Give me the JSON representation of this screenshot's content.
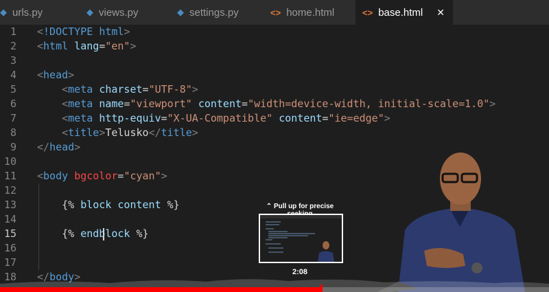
{
  "tabs": [
    {
      "label": "urls.py",
      "icon": "python-file-icon",
      "active": false
    },
    {
      "label": "views.py",
      "icon": "python-file-icon",
      "active": false
    },
    {
      "label": "settings.py",
      "icon": "python-file-icon",
      "active": false
    },
    {
      "label": "home.html",
      "icon": "html-file-icon",
      "active": false
    },
    {
      "label": "base.html",
      "icon": "html-file-icon",
      "active": true,
      "close": "✕"
    }
  ],
  "icons": {
    "python": "◆",
    "html": "<>"
  },
  "editor": {
    "current_line": 15,
    "lines": [
      {
        "n": "1",
        "tokens": [
          [
            "p",
            "<"
          ],
          [
            "tag",
            "!DOCTYPE "
          ],
          [
            "tag",
            "html"
          ],
          [
            "p",
            ">"
          ]
        ]
      },
      {
        "n": "2",
        "tokens": [
          [
            "p",
            "<"
          ],
          [
            "tag",
            "html "
          ],
          [
            "attr",
            "lang"
          ],
          [
            "txt",
            "="
          ],
          [
            "str",
            "\"en\""
          ],
          [
            "p",
            ">"
          ]
        ]
      },
      {
        "n": "3",
        "tokens": []
      },
      {
        "n": "4",
        "tokens": [
          [
            "p",
            "<"
          ],
          [
            "tag",
            "head"
          ],
          [
            "p",
            ">"
          ]
        ]
      },
      {
        "n": "5",
        "tokens": [
          [
            "txt",
            "    "
          ],
          [
            "p",
            "<"
          ],
          [
            "tag",
            "meta "
          ],
          [
            "attr",
            "charset"
          ],
          [
            "txt",
            "="
          ],
          [
            "str",
            "\"UTF-8\""
          ],
          [
            "p",
            ">"
          ]
        ]
      },
      {
        "n": "6",
        "tokens": [
          [
            "txt",
            "    "
          ],
          [
            "p",
            "<"
          ],
          [
            "tag",
            "meta "
          ],
          [
            "attr",
            "name"
          ],
          [
            "txt",
            "="
          ],
          [
            "str",
            "\"viewport\""
          ],
          [
            "txt",
            " "
          ],
          [
            "attr",
            "content"
          ],
          [
            "txt",
            "="
          ],
          [
            "str",
            "\"width=device-width, initial-scale=1.0\""
          ],
          [
            "p",
            ">"
          ]
        ]
      },
      {
        "n": "7",
        "tokens": [
          [
            "txt",
            "    "
          ],
          [
            "p",
            "<"
          ],
          [
            "tag",
            "meta "
          ],
          [
            "attr",
            "http-equiv"
          ],
          [
            "txt",
            "="
          ],
          [
            "str",
            "\"X-UA-Compatible\""
          ],
          [
            "txt",
            " "
          ],
          [
            "attr",
            "content"
          ],
          [
            "txt",
            "="
          ],
          [
            "str",
            "\"ie=edge\""
          ],
          [
            "p",
            ">"
          ]
        ]
      },
      {
        "n": "8",
        "tokens": [
          [
            "txt",
            "    "
          ],
          [
            "p",
            "<"
          ],
          [
            "tag",
            "title"
          ],
          [
            "p",
            ">"
          ],
          [
            "txt",
            "Telusko"
          ],
          [
            "p",
            "</"
          ],
          [
            "tag",
            "title"
          ],
          [
            "p",
            ">"
          ]
        ]
      },
      {
        "n": "9",
        "tokens": [
          [
            "p",
            "</"
          ],
          [
            "tag",
            "head"
          ],
          [
            "p",
            ">"
          ]
        ]
      },
      {
        "n": "10",
        "tokens": []
      },
      {
        "n": "11",
        "tokens": [
          [
            "p",
            "<"
          ],
          [
            "tag",
            "body "
          ],
          [
            "red",
            "bgcolor"
          ],
          [
            "txt",
            "="
          ],
          [
            "str",
            "\"cyan\""
          ],
          [
            "p",
            ">"
          ]
        ]
      },
      {
        "n": "12",
        "tokens": []
      },
      {
        "n": "13",
        "tokens": [
          [
            "txt",
            "    "
          ],
          [
            "jinja",
            "{% "
          ],
          [
            "kw",
            "block"
          ],
          [
            "jinja",
            " "
          ],
          [
            "kw",
            "content"
          ],
          [
            "jinja",
            " %}"
          ]
        ]
      },
      {
        "n": "14",
        "tokens": []
      },
      {
        "n": "15",
        "tokens": [
          [
            "txt",
            "    "
          ],
          [
            "jinja",
            "{% "
          ],
          [
            "kw",
            "endblock"
          ],
          [
            "jinja",
            " %}"
          ]
        ]
      },
      {
        "n": "16",
        "tokens": []
      },
      {
        "n": "17",
        "tokens": []
      },
      {
        "n": "18",
        "tokens": [
          [
            "p",
            "</"
          ],
          [
            "tag",
            "body"
          ],
          [
            "p",
            ">"
          ]
        ]
      }
    ]
  },
  "seek": {
    "tooltip": "⌃ Pull up for precise seeking",
    "time": "2:08",
    "progress": 0.585
  }
}
